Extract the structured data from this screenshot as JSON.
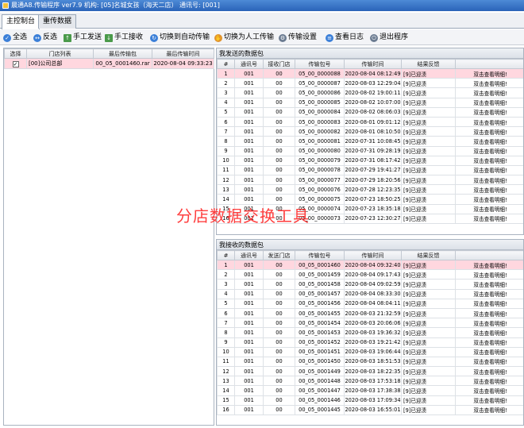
{
  "window": {
    "title": "晨通A8.传输程序 ver7.9 机构: [05]名城女孩（海天二店） 通讯号: [001]"
  },
  "tabs": [
    {
      "label": "主控制台"
    },
    {
      "label": "重传数据"
    }
  ],
  "toolbar": [
    {
      "label": "全选",
      "icon": "select-all-icon"
    },
    {
      "label": "反选",
      "icon": "invert-select-icon"
    },
    {
      "label": "手工发送",
      "icon": "upload-icon"
    },
    {
      "label": "手工接收",
      "icon": "download-icon"
    },
    {
      "label": "切换到自动传输",
      "icon": "refresh-icon"
    },
    {
      "label": "切换为人工传输",
      "icon": "hand-icon"
    },
    {
      "label": "传输设置",
      "icon": "settings-icon"
    },
    {
      "label": "查看日志",
      "icon": "log-icon"
    },
    {
      "label": "退出程序",
      "icon": "exit-icon"
    }
  ],
  "store_list": {
    "headers": [
      "选择",
      "门店列表",
      "最后传输包",
      "最后传输时间"
    ],
    "rows": [
      {
        "checked": true,
        "check_mark": "✓",
        "store": "[00]公司总部",
        "package": "00_05_0001460.rar",
        "time": "2020-08-04 09:33:23"
      }
    ]
  },
  "sent_panel": {
    "title": "我发送的数据包",
    "headers": [
      "#",
      "通讯号",
      "接收门店",
      "传输包号",
      "传输时间",
      "结果反馈",
      ""
    ],
    "rows": [
      {
        "n": "1",
        "comm": "001",
        "store": "00",
        "pkg": "05_00_0000088",
        "time": "2020-08-04 08:12:49",
        "result": "[9]已迎渍",
        "detail": "双击查看明细!"
      },
      {
        "n": "2",
        "comm": "001",
        "store": "00",
        "pkg": "05_00_0000087",
        "time": "2020-08-03 12:29:04",
        "result": "[9]已迎渍",
        "detail": "双击查看明细!"
      },
      {
        "n": "3",
        "comm": "001",
        "store": "00",
        "pkg": "05_00_0000086",
        "time": "2020-08-02 19:00:11",
        "result": "[9]已迎渍",
        "detail": "双击查看明细!"
      },
      {
        "n": "4",
        "comm": "001",
        "store": "00",
        "pkg": "05_00_0000085",
        "time": "2020-08-02 10:07:00",
        "result": "[9]已迎渍",
        "detail": "双击查看明细!"
      },
      {
        "n": "5",
        "comm": "001",
        "store": "00",
        "pkg": "05_00_0000084",
        "time": "2020-08-02 08:06:03",
        "result": "[9]已迎渍",
        "detail": "双击查看明细!"
      },
      {
        "n": "6",
        "comm": "001",
        "store": "00",
        "pkg": "05_00_0000083",
        "time": "2020-08-01 09:01:12",
        "result": "[9]已迎渍",
        "detail": "双击查看明细!"
      },
      {
        "n": "7",
        "comm": "001",
        "store": "00",
        "pkg": "05_00_0000082",
        "time": "2020-08-01 08:10:50",
        "result": "[9]已迎渍",
        "detail": "双击查看明细!"
      },
      {
        "n": "8",
        "comm": "001",
        "store": "00",
        "pkg": "05_00_0000081",
        "time": "2020-07-31 10:08:45",
        "result": "[9]已迎渍",
        "detail": "双击查看明细!"
      },
      {
        "n": "9",
        "comm": "001",
        "store": "00",
        "pkg": "05_00_0000080",
        "time": "2020-07-31 09:28:19",
        "result": "[9]已迎渍",
        "detail": "双击查看明细!"
      },
      {
        "n": "10",
        "comm": "001",
        "store": "00",
        "pkg": "05_00_0000079",
        "time": "2020-07-31 08:17:42",
        "result": "[9]已迎渍",
        "detail": "双击查看明细!"
      },
      {
        "n": "11",
        "comm": "001",
        "store": "00",
        "pkg": "05_00_0000078",
        "time": "2020-07-29 19:41:27",
        "result": "[9]已迎渍",
        "detail": "双击查看明细!"
      },
      {
        "n": "12",
        "comm": "001",
        "store": "00",
        "pkg": "05_00_0000077",
        "time": "2020-07-29 18:20:56",
        "result": "[9]已迎渍",
        "detail": "双击查看明细!"
      },
      {
        "n": "13",
        "comm": "001",
        "store": "00",
        "pkg": "05_00_0000076",
        "time": "2020-07-28 12:23:35",
        "result": "[9]已迎渍",
        "detail": "双击查看明细!"
      },
      {
        "n": "14",
        "comm": "001",
        "store": "00",
        "pkg": "05_00_0000075",
        "time": "2020-07-23 18:50:25",
        "result": "[9]已迎渍",
        "detail": "双击查看明细!"
      },
      {
        "n": "15",
        "comm": "001",
        "store": "00",
        "pkg": "05_00_0000074",
        "time": "2020-07-23 18:35:18",
        "result": "[9]已迎渍",
        "detail": "双击查看明细!"
      },
      {
        "n": "16",
        "comm": "001",
        "store": "00",
        "pkg": "05_00_0000073",
        "time": "2020-07-23 12:30:27",
        "result": "[9]已迎渍",
        "detail": "双击查看明细!"
      }
    ]
  },
  "received_panel": {
    "title": "我接收的数据包",
    "headers": [
      "#",
      "通讯号",
      "发送门店",
      "传输包号",
      "传输时间",
      "结果反馈",
      ""
    ],
    "rows": [
      {
        "n": "1",
        "comm": "001",
        "store": "00",
        "pkg": "00_05_0001460",
        "time": "2020-08-04 09:32:40",
        "result": "[9]已迎渍",
        "detail": "双击查看明细!"
      },
      {
        "n": "2",
        "comm": "001",
        "store": "00",
        "pkg": "00_05_0001459",
        "time": "2020-08-04 09:17:43",
        "result": "[9]已迎渍",
        "detail": "双击查看明细!"
      },
      {
        "n": "3",
        "comm": "001",
        "store": "00",
        "pkg": "00_05_0001458",
        "time": "2020-08-04 09:02:59",
        "result": "[9]已迎渍",
        "detail": "双击查看明细!"
      },
      {
        "n": "4",
        "comm": "001",
        "store": "00",
        "pkg": "00_05_0001457",
        "time": "2020-08-04 08:33:30",
        "result": "[9]已迎渍",
        "detail": "双击查看明细!"
      },
      {
        "n": "5",
        "comm": "001",
        "store": "00",
        "pkg": "00_05_0001456",
        "time": "2020-08-04 08:04:11",
        "result": "[9]已迎渍",
        "detail": "双击查看明细!"
      },
      {
        "n": "6",
        "comm": "001",
        "store": "00",
        "pkg": "00_05_0001455",
        "time": "2020-08-03 21:32:59",
        "result": "[9]已迎渍",
        "detail": "双击查看明细!"
      },
      {
        "n": "7",
        "comm": "001",
        "store": "00",
        "pkg": "00_05_0001454",
        "time": "2020-08-03 20:06:06",
        "result": "[9]已迎渍",
        "detail": "双击查看明细!"
      },
      {
        "n": "8",
        "comm": "001",
        "store": "00",
        "pkg": "00_05_0001453",
        "time": "2020-08-03 19:36:32",
        "result": "[9]已迎渍",
        "detail": "双击查看明细!"
      },
      {
        "n": "9",
        "comm": "001",
        "store": "00",
        "pkg": "00_05_0001452",
        "time": "2020-08-03 19:21:42",
        "result": "[9]已迎渍",
        "detail": "双击查看明细!"
      },
      {
        "n": "10",
        "comm": "001",
        "store": "00",
        "pkg": "00_05_0001451",
        "time": "2020-08-03 19:06:44",
        "result": "[9]已迎渍",
        "detail": "双击查看明细!"
      },
      {
        "n": "11",
        "comm": "001",
        "store": "00",
        "pkg": "00_05_0001450",
        "time": "2020-08-03 18:51:53",
        "result": "[9]已迎渍",
        "detail": "双击查看明细!"
      },
      {
        "n": "12",
        "comm": "001",
        "store": "00",
        "pkg": "00_05_0001449",
        "time": "2020-08-03 18:22:35",
        "result": "[9]已迎渍",
        "detail": "双击查看明细!"
      },
      {
        "n": "13",
        "comm": "001",
        "store": "00",
        "pkg": "00_05_0001448",
        "time": "2020-08-03 17:53:18",
        "result": "[9]已迎渍",
        "detail": "双击查看明细!"
      },
      {
        "n": "14",
        "comm": "001",
        "store": "00",
        "pkg": "00_05_0001447",
        "time": "2020-08-03 17:38:38",
        "result": "[9]已迎渍",
        "detail": "双击查看明细!"
      },
      {
        "n": "15",
        "comm": "001",
        "store": "00",
        "pkg": "00_05_0001446",
        "time": "2020-08-03 17:09:34",
        "result": "[9]已迎渍",
        "detail": "双击查看明细!"
      },
      {
        "n": "16",
        "comm": "001",
        "store": "00",
        "pkg": "00_05_0001445",
        "time": "2020-08-03 16:55:01",
        "result": "[9]已迎渍",
        "detail": "双击查看明细!"
      }
    ]
  },
  "watermark": "分店数据交换工具",
  "colors": {
    "selected_row": "#ffd7df",
    "watermark": "#ff2a2a",
    "title_bar": "#2a63b8"
  }
}
